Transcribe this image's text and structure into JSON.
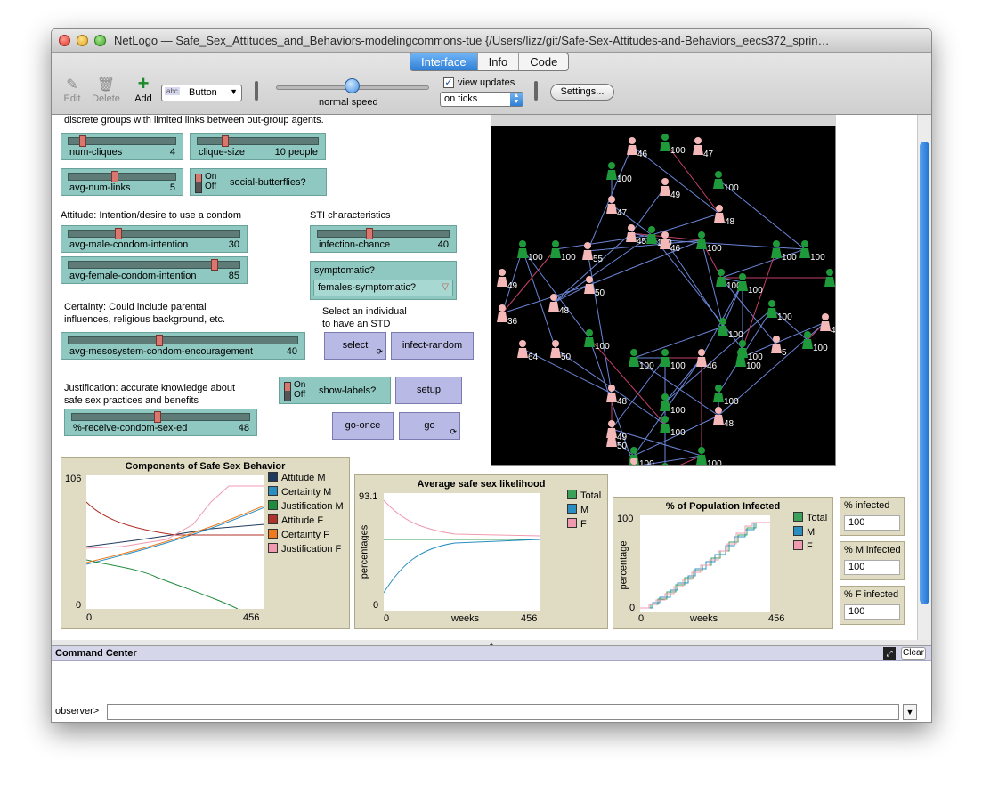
{
  "window": {
    "title": "NetLogo — Safe_Sex_Attitudes_and_Behaviors-modelingcommons-tue {/Users/lizz/git/Safe-Sex-Attitudes-and-Behaviors_eecs372_sprin…"
  },
  "tabs": [
    {
      "label": "Interface",
      "active": true
    },
    {
      "label": "Info",
      "active": false
    },
    {
      "label": "Code",
      "active": false
    }
  ],
  "toolbar": {
    "edit_label": "Edit",
    "delete_label": "Delete",
    "add_label": "Add",
    "widget_type": "Button",
    "widget_abc": "abc",
    "speed_label": "normal speed",
    "view_updates_label": "view updates",
    "view_updates_checked": true,
    "update_mode": "on ticks",
    "settings_label": "Settings..."
  },
  "notes": {
    "top_cut": "discrete groups with limited links between out-group agents.",
    "attitude": "Attitude:  Intention/desire to use a condom",
    "sti": "STI characteristics",
    "certainty_1": "Certainty: Could include parental",
    "certainty_2": "influences, religious background, etc.",
    "select_1": "Select an individual",
    "select_2": "to have an STD",
    "justification_1": "Justification: accurate knowledge about",
    "justification_2": "safe sex practices and benefits"
  },
  "sliders": {
    "num_cliques": {
      "name": "num-cliques",
      "value": "4"
    },
    "clique_size": {
      "name": "clique-size",
      "value": "10 people"
    },
    "avg_num_links": {
      "name": "avg-num-links",
      "value": "5"
    },
    "male_intent": {
      "name": "avg-male-condom-intention",
      "value": "30"
    },
    "female_intent": {
      "name": "avg-female-condom-intention",
      "value": "85"
    },
    "infection_chance": {
      "name": "infection-chance",
      "value": "40"
    },
    "mesosystem": {
      "name": "avg-mesosystem-condom-encouragement",
      "value": "40"
    },
    "sex_ed": {
      "name": "%-receive-condom-sex-ed",
      "value": "48"
    }
  },
  "switches": {
    "on": "On",
    "off": "Off",
    "social_butterflies": "social-butterflies?",
    "show_labels": "show-labels?"
  },
  "chooser": {
    "name": "symptomatic?",
    "value": "females-symptomatic?"
  },
  "buttons": {
    "select": "select",
    "infect_random": "infect-random",
    "setup": "setup",
    "go_once": "go-once",
    "go": "go",
    "forever_icon": "⟳"
  },
  "plots": {
    "components": {
      "title": "Components of Safe Sex Behavior",
      "ymax": "106",
      "ymin": "0",
      "xmin": "0",
      "xmax": "456",
      "legend": [
        {
          "name": "Attitude M",
          "color": "#1f3a5f"
        },
        {
          "name": "Certainty M",
          "color": "#2a8fc0"
        },
        {
          "name": "Justification M",
          "color": "#1e8a3c"
        },
        {
          "name": "Attitude F",
          "color": "#b03228"
        },
        {
          "name": "Certainty F",
          "color": "#ef7a1e"
        },
        {
          "name": "Justification F",
          "color": "#f09ab0"
        }
      ]
    },
    "likelihood": {
      "title": "Average safe sex likelihood",
      "ymax": "93.1",
      "ymin": "0",
      "xmin": "0",
      "xmax": "456",
      "xlabel": "weeks",
      "ylabel": "percentages",
      "legend": [
        {
          "name": "Total",
          "color": "#3aa05a"
        },
        {
          "name": "M",
          "color": "#2a8fc0"
        },
        {
          "name": "F",
          "color": "#f09ab0"
        }
      ]
    },
    "infected": {
      "title": "% of Population Infected",
      "ymax": "100",
      "ymin": "0",
      "xmin": "0",
      "xmax": "456",
      "xlabel": "weeks",
      "ylabel": "percentage",
      "legend": [
        {
          "name": "Total",
          "color": "#3aa05a"
        },
        {
          "name": "M",
          "color": "#2a8fc0"
        },
        {
          "name": "F",
          "color": "#f09ab0"
        }
      ]
    }
  },
  "monitors": [
    {
      "name": "% infected",
      "value": "100"
    },
    {
      "name": "% M infected",
      "value": "100"
    },
    {
      "name": "% F infected",
      "value": "100"
    }
  ],
  "view_labels": [
    "46",
    "100",
    "47",
    "100",
    "49",
    "100",
    "47",
    "48",
    "100",
    "45",
    "46",
    "100",
    "100",
    "100",
    "55",
    "100",
    "100",
    "49",
    "48",
    "36",
    "50",
    "100",
    "100",
    "100",
    "100",
    "4",
    "50",
    "100",
    "100",
    "100",
    "5",
    "100",
    "64",
    "100",
    "100",
    "46",
    "100",
    "48",
    "100",
    "100",
    "49",
    "100",
    "48",
    "50",
    "100",
    "100",
    "49",
    "100"
  ],
  "command_center": {
    "title": "Command Center",
    "clear_label": "Clear",
    "observer_label": "observer>"
  },
  "colors": {
    "slider_bg": "#8ec8c0",
    "button_bg": "#b9b9e6",
    "plot_bg": "#e0dcc4",
    "agent_green": "#1e9a3a",
    "agent_pink": "#f4b8b8",
    "link_blue": "#6b86d8",
    "link_pink": "#c4406a"
  }
}
